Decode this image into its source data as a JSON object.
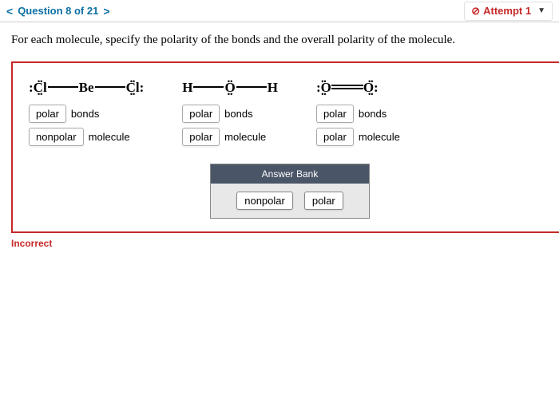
{
  "nav": {
    "prev": "<",
    "label": "Question 8 of 21",
    "next": ">"
  },
  "attempt": {
    "icon": "⊘",
    "label": "Attempt 1"
  },
  "question": "For each molecule, specify the polarity of the bonds and the overall polarity of the molecule.",
  "molecules": [
    {
      "bonds_value": "polar",
      "bonds_label": "bonds",
      "molecule_value": "nonpolar",
      "molecule_label": "molecule"
    },
    {
      "bonds_value": "polar",
      "bonds_label": "bonds",
      "molecule_value": "polar",
      "molecule_label": "molecule"
    },
    {
      "bonds_value": "polar",
      "bonds_label": "bonds",
      "molecule_value": "polar",
      "molecule_label": "molecule"
    }
  ],
  "bank": {
    "header": "Answer Bank",
    "chips": [
      "nonpolar",
      "polar"
    ]
  },
  "feedback": "Incorrect"
}
